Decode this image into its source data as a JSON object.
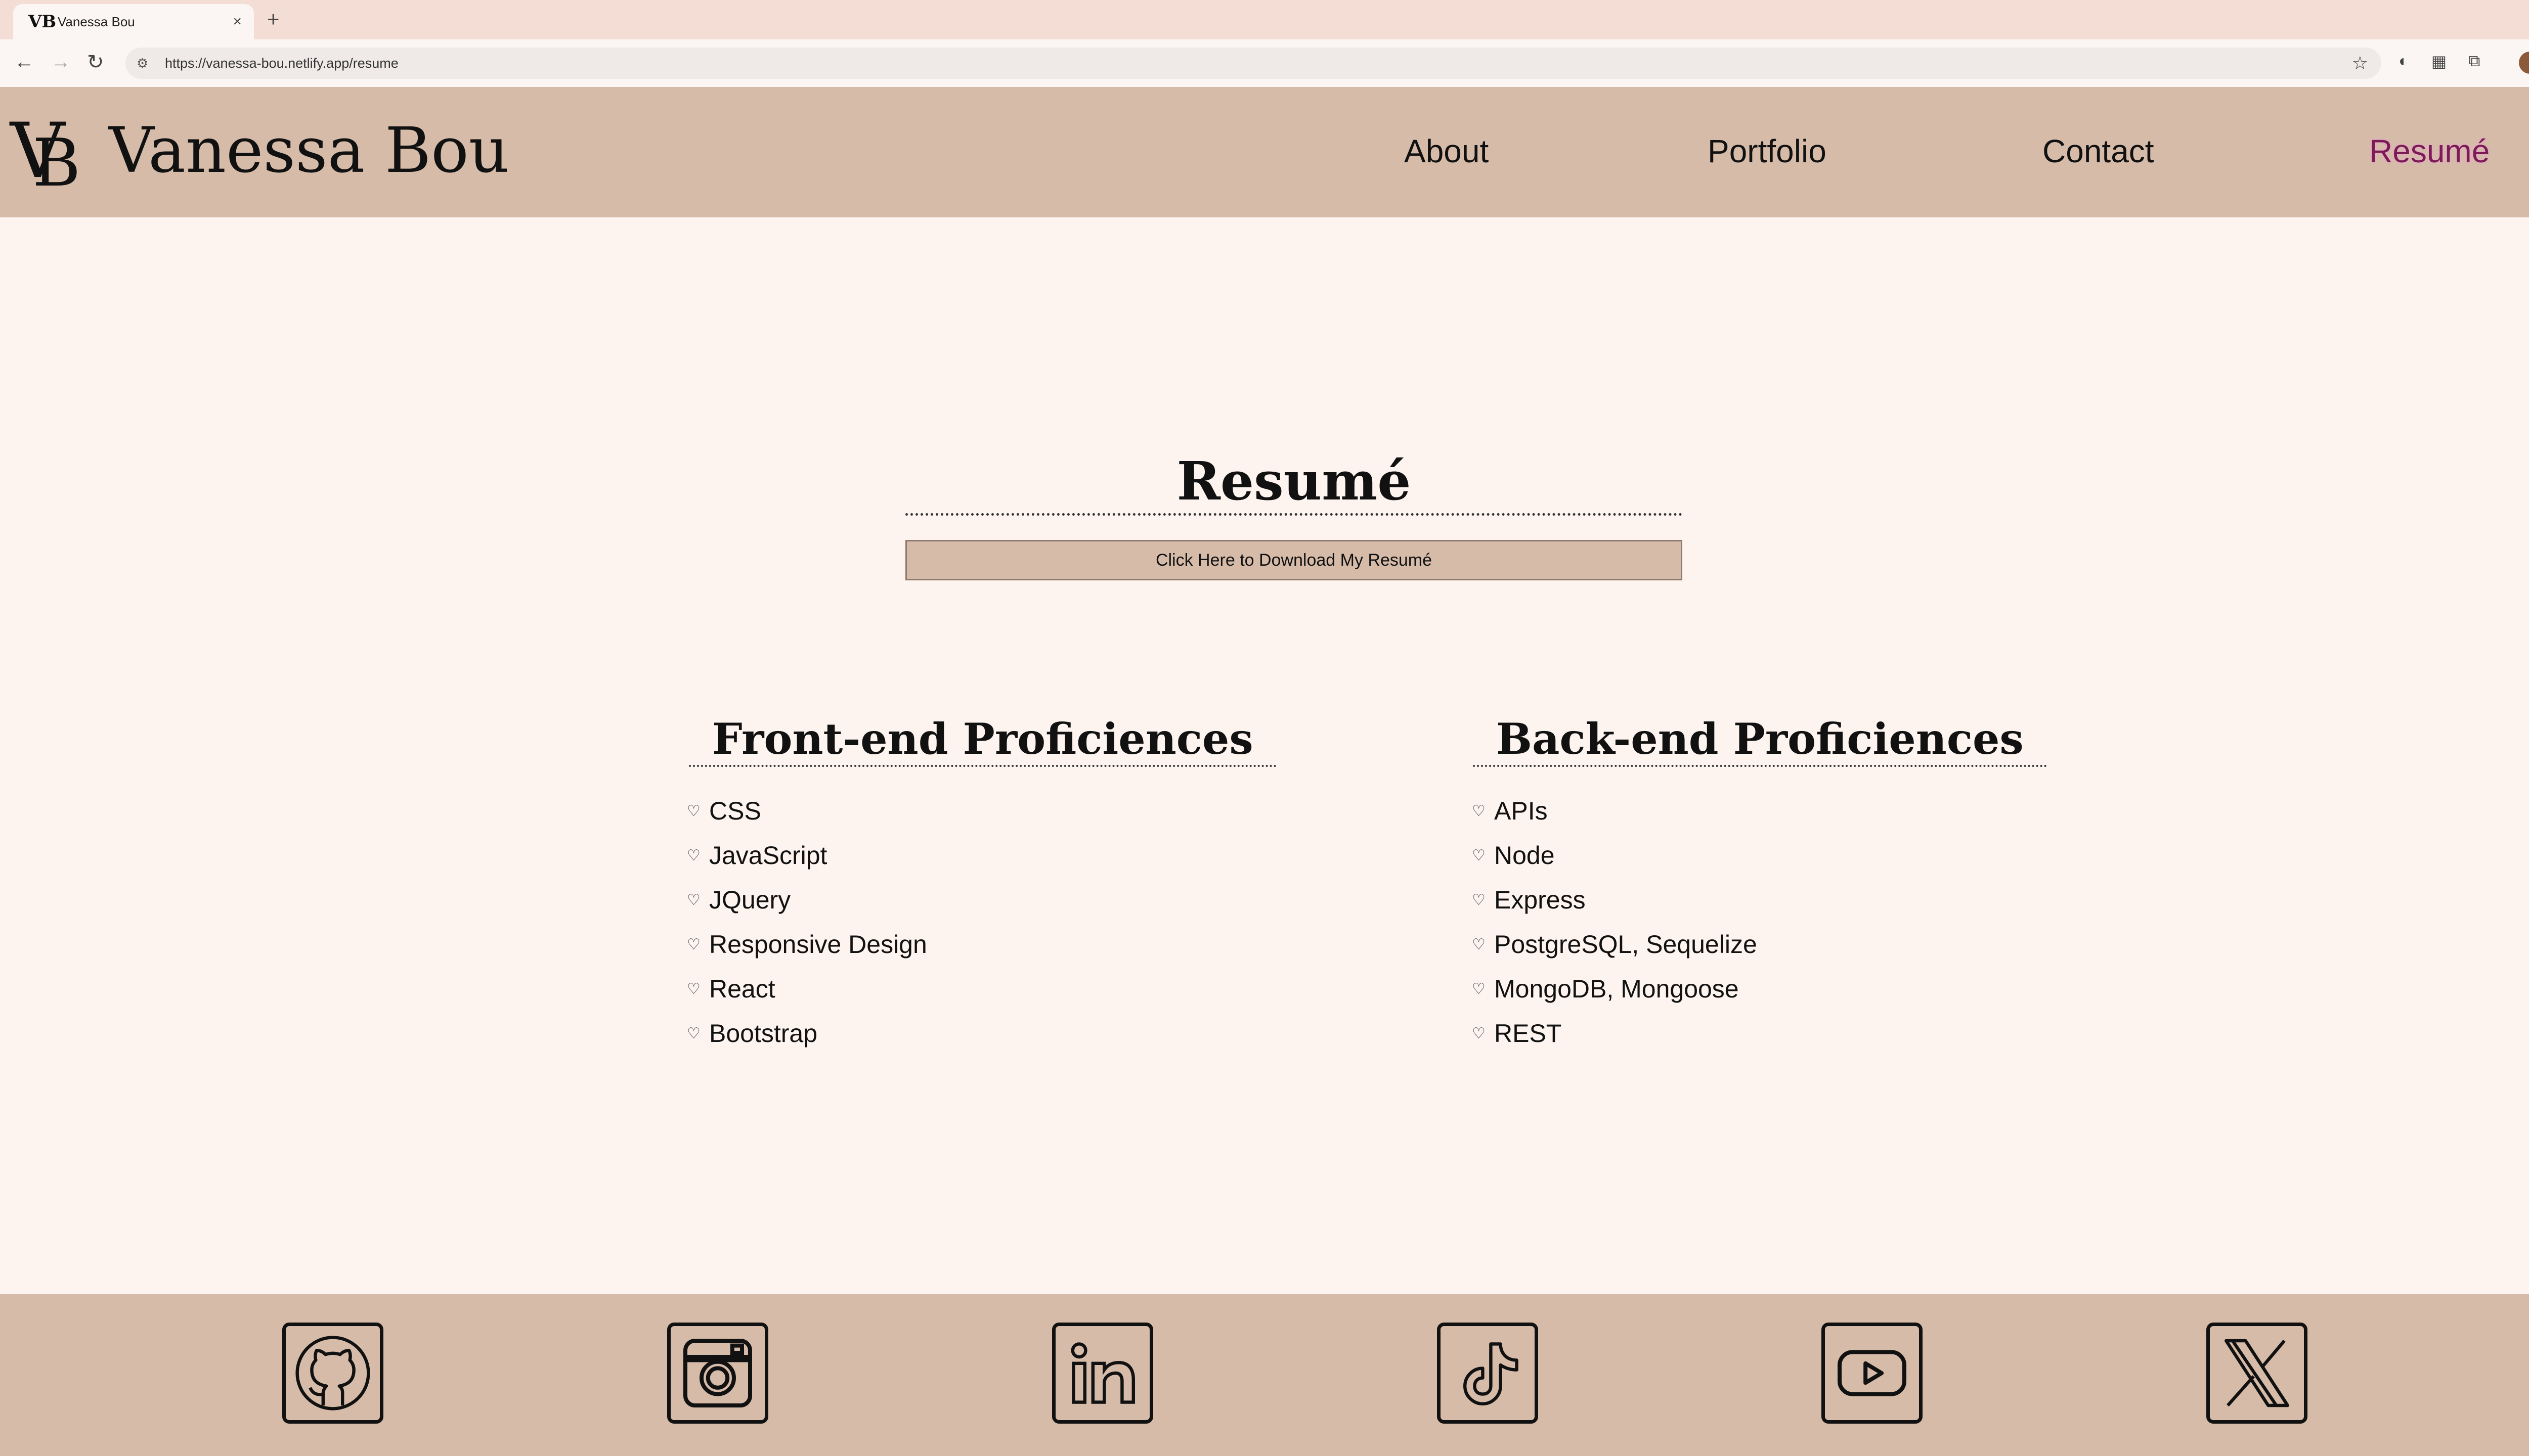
{
  "browser": {
    "tab_title": "Vanessa Bou",
    "tab_favicon": "VB",
    "new_tab": "+",
    "close": "×",
    "url": "https://vanessa-bou.netlify.app/resume"
  },
  "header": {
    "logo_v": "V",
    "logo_b": "B",
    "brand": "Vanessa Bou",
    "nav": [
      {
        "label": "About"
      },
      {
        "label": "Portfolio"
      },
      {
        "label": "Contact"
      },
      {
        "label": "Resumé"
      }
    ],
    "active_nav": "Resumé",
    "active_color": "#7d1b57"
  },
  "main": {
    "title": "Resumé",
    "download_label": "Click Here to Download My Resumé",
    "frontend": {
      "heading": "Front-end Proficiences",
      "items": [
        "CSS",
        "JavaScript",
        "JQuery",
        "Responsive Design",
        "React",
        "Bootstrap"
      ]
    },
    "backend": {
      "heading": "Back-end Proficiences",
      "items": [
        "APIs",
        "Node",
        "Express",
        "PostgreSQL, Sequelize",
        "MongoDB, Mongoose",
        "REST"
      ]
    },
    "bullet_icon": "heart-icon"
  },
  "footer": {
    "social": [
      "github-icon",
      "instagram-icon",
      "linkedin-icon",
      "tiktok-icon",
      "youtube-icon",
      "x-icon"
    ]
  },
  "colors": {
    "page_bg": "#fdf3ef",
    "header_bg": "#d6bba9",
    "tabbar_bg": "#f3ddd4"
  }
}
